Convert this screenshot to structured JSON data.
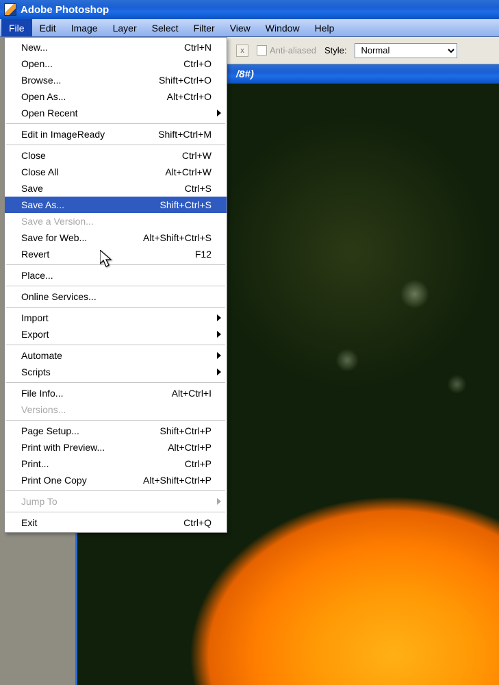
{
  "app": {
    "title": "Adobe Photoshop"
  },
  "menubar": [
    "File",
    "Edit",
    "Image",
    "Layer",
    "Select",
    "Filter",
    "View",
    "Window",
    "Help"
  ],
  "menubar_open_index": 0,
  "optionsbar": {
    "xglyph": "x",
    "antialiased_label": "Anti-aliased",
    "style_label": "Style:",
    "style_value": "Normal"
  },
  "document": {
    "title_visible_fragment": "/8#)"
  },
  "file_menu": [
    {
      "type": "item",
      "label": "New...",
      "shortcut": "Ctrl+N"
    },
    {
      "type": "item",
      "label": "Open...",
      "shortcut": "Ctrl+O"
    },
    {
      "type": "item",
      "label": "Browse...",
      "shortcut": "Shift+Ctrl+O"
    },
    {
      "type": "item",
      "label": "Open As...",
      "shortcut": "Alt+Ctrl+O"
    },
    {
      "type": "submenu",
      "label": "Open Recent"
    },
    {
      "type": "sep"
    },
    {
      "type": "item",
      "label": "Edit in ImageReady",
      "shortcut": "Shift+Ctrl+M"
    },
    {
      "type": "sep"
    },
    {
      "type": "item",
      "label": "Close",
      "shortcut": "Ctrl+W"
    },
    {
      "type": "item",
      "label": "Close All",
      "shortcut": "Alt+Ctrl+W"
    },
    {
      "type": "item",
      "label": "Save",
      "shortcut": "Ctrl+S"
    },
    {
      "type": "item",
      "label": "Save As...",
      "shortcut": "Shift+Ctrl+S",
      "highlight": true
    },
    {
      "type": "item",
      "label": "Save a Version...",
      "disabled": true
    },
    {
      "type": "item",
      "label": "Save for Web...",
      "shortcut": "Alt+Shift+Ctrl+S"
    },
    {
      "type": "item",
      "label": "Revert",
      "shortcut": "F12"
    },
    {
      "type": "sep"
    },
    {
      "type": "item",
      "label": "Place..."
    },
    {
      "type": "sep"
    },
    {
      "type": "item",
      "label": "Online Services..."
    },
    {
      "type": "sep"
    },
    {
      "type": "submenu",
      "label": "Import"
    },
    {
      "type": "submenu",
      "label": "Export"
    },
    {
      "type": "sep"
    },
    {
      "type": "submenu",
      "label": "Automate"
    },
    {
      "type": "submenu",
      "label": "Scripts"
    },
    {
      "type": "sep"
    },
    {
      "type": "item",
      "label": "File Info...",
      "shortcut": "Alt+Ctrl+I"
    },
    {
      "type": "item",
      "label": "Versions...",
      "disabled": true
    },
    {
      "type": "sep"
    },
    {
      "type": "item",
      "label": "Page Setup...",
      "shortcut": "Shift+Ctrl+P"
    },
    {
      "type": "item",
      "label": "Print with Preview...",
      "shortcut": "Alt+Ctrl+P"
    },
    {
      "type": "item",
      "label": "Print...",
      "shortcut": "Ctrl+P"
    },
    {
      "type": "item",
      "label": "Print One Copy",
      "shortcut": "Alt+Shift+Ctrl+P"
    },
    {
      "type": "sep"
    },
    {
      "type": "submenu",
      "label": "Jump To",
      "disabled": true
    },
    {
      "type": "sep"
    },
    {
      "type": "item",
      "label": "Exit",
      "shortcut": "Ctrl+Q"
    }
  ]
}
